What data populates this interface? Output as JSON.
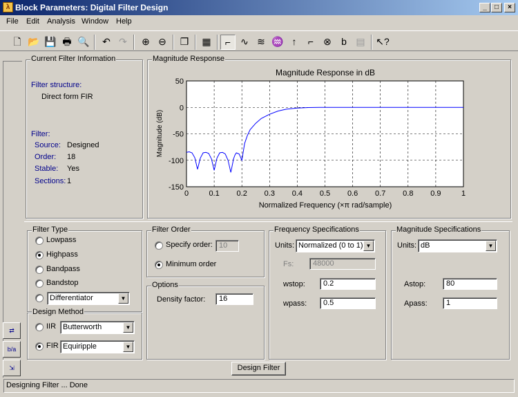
{
  "window": {
    "title": "Block Parameters: Digital Filter Design"
  },
  "menu": [
    "File",
    "Edit",
    "Analysis",
    "Window",
    "Help"
  ],
  "toolbar": {
    "icons": [
      "new-file-icon",
      "open-folder-icon",
      "save-icon",
      "print-icon",
      "print-preview-icon",
      "undo-icon",
      "redo-icon",
      "zoom-in-icon",
      "zoom-out-icon",
      "new-window-icon",
      "full-view-icon",
      "magnitude-response-icon",
      "phase-response-icon",
      "magnitude-phase-icon",
      "group-delay-icon",
      "impulse-response-icon",
      "step-response-icon",
      "pole-zero-icon",
      "coefficients-icon",
      "filter-info-icon",
      "whats-this-icon"
    ]
  },
  "info": {
    "title": "Current Filter Information",
    "structure_label": "Filter structure:",
    "structure_value": "Direct form FIR",
    "filter_label": "Filter:",
    "source_label": "Source:",
    "source_value": "Designed",
    "order_label": "Order:",
    "order_value": "18",
    "stable_label": "Stable:",
    "stable_value": "Yes",
    "sections_label": "Sections:",
    "sections_value": "1"
  },
  "plot": {
    "group_title": "Magnitude Response",
    "title": "Magnitude Response in dB",
    "xlabel": "Normalized Frequency  (×π rad/sample)",
    "ylabel": "Magnitude (dB)"
  },
  "chart_data": {
    "type": "line",
    "title": "Magnitude Response in dB",
    "xlabel": "Normalized Frequency  (×π rad/sample)",
    "ylabel": "Magnitude (dB)",
    "xlim": [
      0,
      1
    ],
    "ylim": [
      -150,
      50
    ],
    "xticks": [
      0,
      0.1,
      0.2,
      0.3,
      0.4,
      0.5,
      0.6,
      0.7,
      0.8,
      0.9,
      1
    ],
    "yticks": [
      50,
      0,
      -50,
      -100,
      -150
    ],
    "grid": true,
    "color": "#0000ff",
    "x": [
      0,
      0.01,
      0.02,
      0.03,
      0.04,
      0.05,
      0.06,
      0.07,
      0.08,
      0.09,
      0.1,
      0.11,
      0.12,
      0.13,
      0.14,
      0.15,
      0.16,
      0.17,
      0.175,
      0.18,
      0.19,
      0.2,
      0.21,
      0.22,
      0.23,
      0.25,
      0.27,
      0.3,
      0.33,
      0.36,
      0.4,
      0.44,
      0.48,
      0.5,
      0.55,
      0.6,
      0.7,
      0.8,
      0.9,
      1.0
    ],
    "y": [
      -85,
      -84,
      -86,
      -95,
      -117,
      -96,
      -86,
      -85,
      -87,
      -97,
      -119,
      -96,
      -86,
      -85,
      -88,
      -100,
      -123,
      -97,
      -90,
      -86,
      -88,
      -100,
      -68,
      -53,
      -42,
      -30,
      -21,
      -13,
      -7,
      -3.5,
      -1.2,
      -0.3,
      0,
      0,
      0,
      0,
      0,
      0,
      0,
      0
    ]
  },
  "filter_type": {
    "title": "Filter Type",
    "options": [
      "Lowpass",
      "Highpass",
      "Bandpass",
      "Bandstop"
    ],
    "selected": "Highpass",
    "other_combo": "Differentiator"
  },
  "design_method": {
    "title": "Design Method",
    "iir_label": "IIR",
    "iir_combo": "Butterworth",
    "fir_label": "FIR",
    "fir_combo": "Equiripple",
    "selected": "FIR"
  },
  "filter_order": {
    "title": "Filter Order",
    "specify_label": "Specify order:",
    "specify_value": "10",
    "minimum_label": "Minimum order",
    "selected": "Minimum order"
  },
  "options": {
    "title": "Options",
    "density_label": "Density factor:",
    "density_value": "16"
  },
  "freq_specs": {
    "title": "Frequency Specifications",
    "units_label": "Units:",
    "units_value": "Normalized (0 to 1)",
    "fs_label": "Fs:",
    "fs_value": "48000",
    "wstop_label": "wstop:",
    "wstop_value": "0.2",
    "wpass_label": "wpass:",
    "wpass_value": "0.5"
  },
  "mag_specs": {
    "title": "Magnitude Specifications",
    "units_label": "Units:",
    "units_value": "dB",
    "astop_label": "Astop:",
    "astop_value": "80",
    "apass_label": "Apass:",
    "apass_value": "1"
  },
  "design_button": "Design Filter",
  "status": "Designing Filter ... Done"
}
